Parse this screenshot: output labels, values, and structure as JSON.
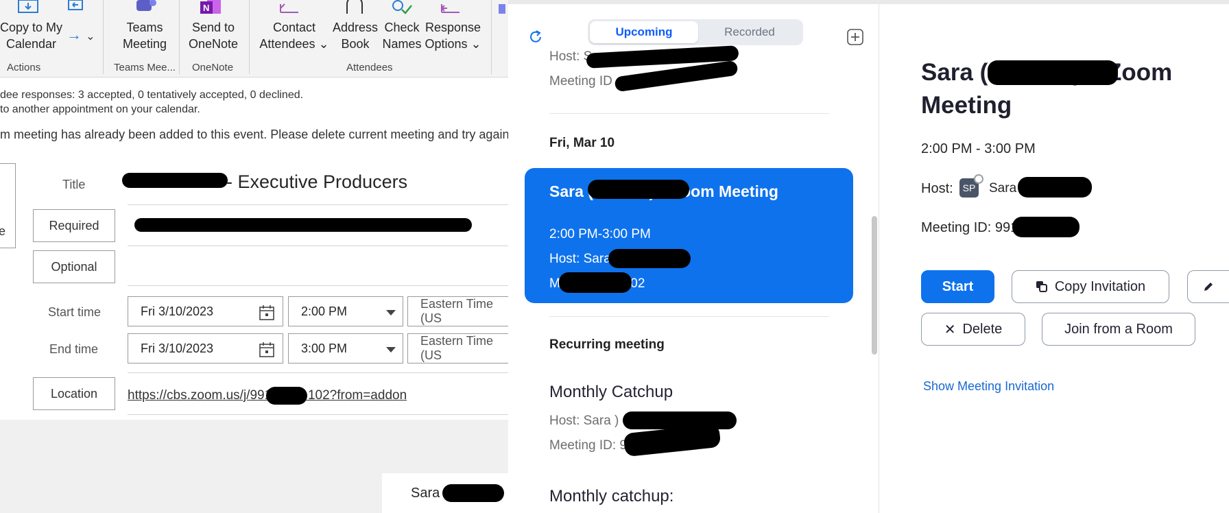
{
  "ribbon": {
    "copy_to_calendar": "Copy to My\nCalendar",
    "teams_meeting": "Teams\nMeeting",
    "send_to_onenote": "Send to\nOneNote",
    "contact_attendees": "Contact\nAttendees ⌄",
    "address_book": "Address\nBook",
    "check_names": "Check\nNames",
    "response_options": "Response\nOptions ⌄",
    "groups": {
      "actions": "Actions",
      "teams": "Teams Mee...",
      "onenote": "OneNote",
      "attendees": "Attendees"
    }
  },
  "outlook": {
    "info_responses": "dee responses: 3 accepted, 0 tentatively accepted, 0 declined.",
    "info_adjacent": "to another appointment on your calendar.",
    "info_error": "m meeting has already been added to this event. Please delete current meeting and try again.",
    "side_letter": "e",
    "title_label": "Title",
    "title_value": "- Executive Producers",
    "required_label": "Required",
    "optional_label": "Optional",
    "start_label": "Start time",
    "end_label": "End time",
    "start_date": "Fri 3/10/2023",
    "start_time": "2:00 PM",
    "end_date": "Fri 3/10/2023",
    "end_time": "3:00 PM",
    "timezone": "Eastern Time (US",
    "location_label": "Location",
    "location_value": "https://cbs.zoom.us/j/991          102?from=addon",
    "body_text": "Sara"
  },
  "zoom": {
    "tabs": {
      "upcoming": "Upcoming",
      "recorded": "Recorded"
    },
    "top_host": "Host: Sa",
    "top_meeting_id": "Meeting ID",
    "date_header": "Fri, Mar 10",
    "selected": {
      "title": "Sara                        (she/her)'s Zoom Meeting",
      "time": "2:00 PM-3:00 PM",
      "host": "Host: Sara                       (she/her)",
      "meeting_id": "Meeting ID: 9                   02"
    },
    "recurring_header": "Recurring meeting",
    "monthly1": {
      "title": "Monthly Catchup",
      "host": "Host: Sara                             )",
      "meeting_id": "Meeting ID: 9"
    },
    "monthly2_title": "Monthly catchup:",
    "detail": {
      "title": "Sara                   (she/her)'s Zoom Meeting",
      "time": "2:00 PM - 3:00 PM",
      "host_label": "Host:",
      "avatar": "SP",
      "host_name": "Sara                           (she/her)",
      "meeting_id": "Meeting ID: 991               02",
      "start": "Start",
      "copy_invitation": "Copy Invitation",
      "delete": "Delete",
      "join_room": "Join from a Room",
      "show_invitation": "Show Meeting Invitation"
    }
  },
  "colors": {
    "zoom_blue": "#0e72ed",
    "link_blue": "#1967d2",
    "ribbon_bg": "#f3f3f3"
  }
}
